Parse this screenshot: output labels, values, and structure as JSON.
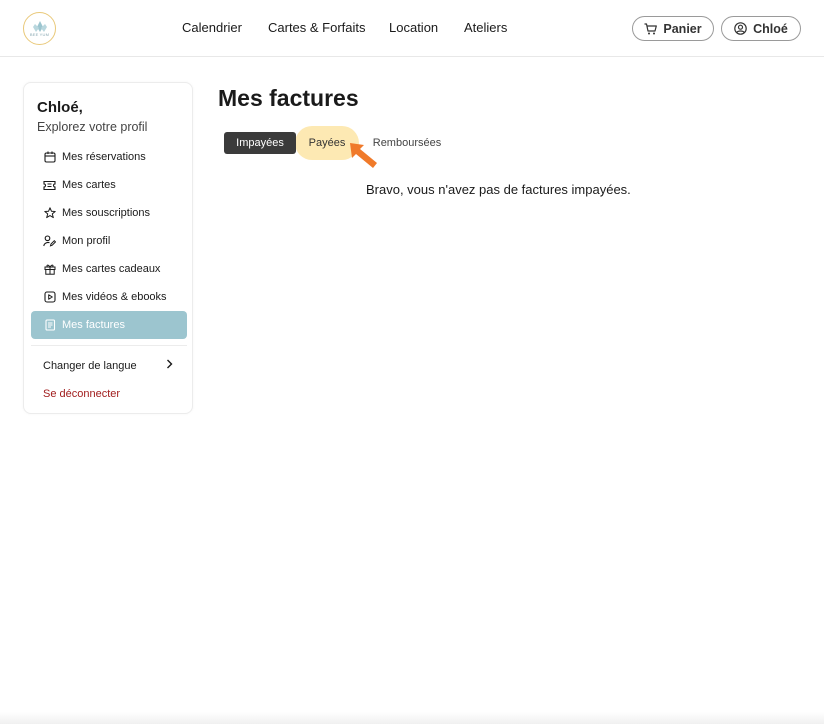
{
  "header": {
    "logo_text": "BEE YUM",
    "nav": [
      "Calendrier",
      "Cartes & Forfaits",
      "Location",
      "Ateliers"
    ],
    "cart_label": "Panier",
    "user_label": "Chloé"
  },
  "sidebar": {
    "greeting": "Chloé,",
    "subtitle": "Explorez votre profil",
    "items": [
      {
        "label": "Mes réservations",
        "icon": "calendar-icon"
      },
      {
        "label": "Mes cartes",
        "icon": "ticket-icon"
      },
      {
        "label": "Mes souscriptions",
        "icon": "star-icon"
      },
      {
        "label": "Mon profil",
        "icon": "user-edit-icon"
      },
      {
        "label": "Mes cartes cadeaux",
        "icon": "gift-icon"
      },
      {
        "label": "Mes vidéos & ebooks",
        "icon": "play-icon"
      },
      {
        "label": "Mes factures",
        "icon": "invoice-icon",
        "active": true
      }
    ],
    "language_label": "Changer de langue",
    "logout_label": "Se déconnecter"
  },
  "main": {
    "title": "Mes factures",
    "tabs": [
      "Impayées",
      "Payées",
      "Remboursées"
    ],
    "active_tab": "Impayées",
    "empty_message": "Bravo, vous n'avez pas de factures impayées."
  },
  "colors": {
    "active_item": "#9cc5cf",
    "active_tab": "#3b3b3b",
    "hover_highlight": "#fde9b3",
    "logout": "#a11d1d",
    "pointer": "#f07a2a"
  }
}
